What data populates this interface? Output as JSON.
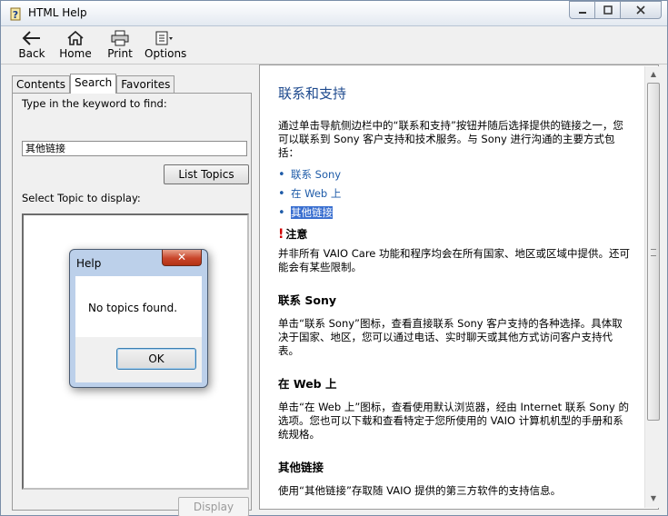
{
  "window": {
    "title": "HTML Help"
  },
  "toolbar": [
    {
      "label": "Back",
      "icon": "back-arrow-icon"
    },
    {
      "label": "Home",
      "icon": "home-icon"
    },
    {
      "label": "Print",
      "icon": "printer-icon"
    },
    {
      "label": "Options",
      "icon": "options-icon"
    }
  ],
  "tabs": [
    "Contents",
    "Search",
    "Favorites"
  ],
  "active_tab": "Search",
  "search": {
    "keyword_label": "Type in the keyword to find:",
    "keyword_value": "其他链接",
    "list_topics_button": "List Topics",
    "select_topic_label": "Select Topic to display:",
    "display_button": "Display"
  },
  "dialog": {
    "title": "Help",
    "message": "No topics found.",
    "ok_button": "OK",
    "close_glyph": "✕"
  },
  "article": {
    "heading": "联系和支持",
    "intro": "通过单击导航侧边栏中的“联系和支持”按钮并随后选择提供的链接之一，您可以联系到 Sony 客户支持和技术服务。与 Sony 进行沟通的主要方式包括：",
    "links": [
      "联系 Sony",
      "在 Web 上",
      "其他链接"
    ],
    "selected_link": "其他链接",
    "note_mark": "!",
    "note_title": "注意",
    "note_text": "并非所有 VAIO Care 功能和程序均会在所有国家、地区或区域中提供。还可能会有某些限制。",
    "sections": [
      {
        "title": "联系 Sony",
        "text": "单击“联系 Sony”图标，查看直接联系 Sony 客户支持的各种选择。具体取决于国家、地区，您可以通过电话、实时聊天或其他方式访问客户支持代表。"
      },
      {
        "title": "在 Web 上",
        "text": "单击“在 Web 上”图标，查看使用默认浏览器，经由 Internet 联系 Sony 的选项。您也可以下载和查看特定于您所使用的 VAIO 计算机机型的手册和系统规格。"
      },
      {
        "title": "其他链接",
        "text": "使用“其他链接”存取随 VAIO 提供的第三方软件的支持信息。"
      }
    ]
  },
  "colors": {
    "heading": "#1e4a8e",
    "link": "#1e5ba8",
    "selection": "#3a6fd0",
    "note_mark": "#d00000",
    "dialog_close": "#c8452a"
  }
}
